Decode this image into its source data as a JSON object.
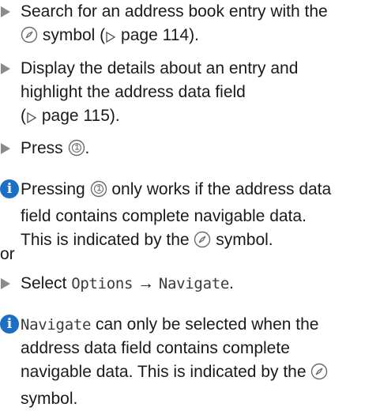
{
  "steps": [
    {
      "line1": "Search for an address book entry with the",
      "line2_post": " symbol (",
      "ref": "page 114",
      "line2_end": ")."
    },
    {
      "line1": "Display the details about an entry and",
      "line2": "highlight the address data field",
      "line3_pre": "(",
      "ref": "page 115",
      "line3_end": ")."
    },
    {
      "pre": "Press ",
      "post": "."
    }
  ],
  "note1": {
    "pre": "Pressing ",
    "post": " only works if the address data",
    "line2": "field contains complete navigable data.",
    "line3_pre": "This is indicated by the ",
    "line3_post": " symbol."
  },
  "or_label": "or",
  "step4": {
    "pre": "Select ",
    "menu": "Options",
    "arrow": "→",
    "item": "Navigate",
    "post": "."
  },
  "note2": {
    "item": "Navigate",
    "post": " can only be selected when the",
    "line2": "address data field contains complete",
    "line3": "navigable data. This is indicated by the ",
    "line4": "symbol."
  },
  "icons": {
    "info": "info-icon",
    "compass": "compass-icon",
    "dial": "dial-icon",
    "arrow_bullet": "step-arrow-icon",
    "ref_triangle": "reference-triangle-icon"
  },
  "colors": {
    "info_icon": "#1c6fc2",
    "bullet": "#8a8a8a"
  }
}
